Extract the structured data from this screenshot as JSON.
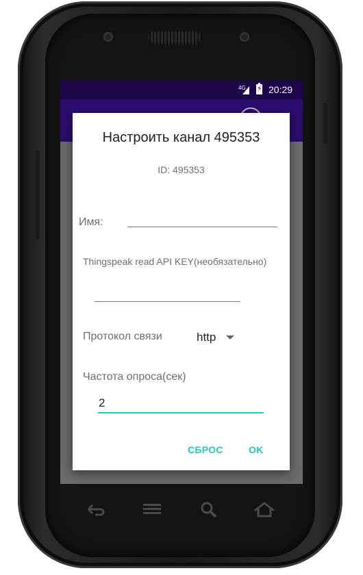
{
  "statusbar": {
    "network": "4G",
    "time": "20:29"
  },
  "dialog": {
    "title": "Настроить канал 495353",
    "id_text": "ID:  495353",
    "name_label": "Имя:",
    "name_value": "",
    "api_key_label": "Thingspeak read API KEY(необязательно)",
    "api_key_value": "",
    "protocol_label": "Протокол связи",
    "protocol_value": "http",
    "frequency_label": "Частота опроса(сек)",
    "frequency_value": "2",
    "reset_button": "СБРОС",
    "ok_button": "OK"
  },
  "colors": {
    "accent": "#26c7c0",
    "status_bar": "#1d0549",
    "toolbar": "#2a0d6d"
  },
  "navbar": {
    "icons": [
      "back-icon",
      "menu-icon",
      "search-icon",
      "home-icon"
    ]
  }
}
